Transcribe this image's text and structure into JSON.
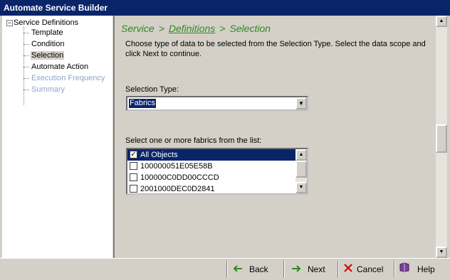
{
  "window": {
    "title": "Automate Service Builder"
  },
  "tree": {
    "expander": "−",
    "root_label": "Service Definitions",
    "items": [
      {
        "label": "Template"
      },
      {
        "label": "Condition"
      },
      {
        "label": "Selection"
      },
      {
        "label": "Automate Action"
      },
      {
        "label": "Execution Frequency"
      },
      {
        "label": "Summary"
      }
    ]
  },
  "breadcrumb": {
    "step1": "Service",
    "sep": ">",
    "step2": "Definitions",
    "step3": "Selection"
  },
  "instructions": "Choose type of data to be selected from the Selection Type. Select the data scope and click Next to continue.",
  "selection_type": {
    "label": "Selection Type:",
    "value": "Fabrics"
  },
  "fabric_list": {
    "label": "Select one or more fabrics from the list:",
    "items": [
      {
        "label": "All Objects",
        "checked": true
      },
      {
        "label": "100000051E05E58B",
        "checked": false
      },
      {
        "label": "100000C0DD00CCCD",
        "checked": false
      },
      {
        "label": "2001000DEC0D2841",
        "checked": false
      }
    ]
  },
  "buttons": {
    "back": "Back",
    "next": "Next",
    "cancel": "Cancel",
    "help": "Help"
  },
  "icons": {
    "back": "left-arrow-icon",
    "next": "right-arrow-icon",
    "cancel": "red-x-icon",
    "help": "help-book-icon"
  },
  "colors": {
    "title_bar": "#0a246a",
    "breadcrumb": "#2e8b20",
    "selection": "#0a246a",
    "disabled_tree_item": "#8fa6c8",
    "cancel_x": "#cc0000"
  },
  "glyphs": {
    "check": "✓",
    "scroll_up": "▲",
    "scroll_down": "▼"
  }
}
